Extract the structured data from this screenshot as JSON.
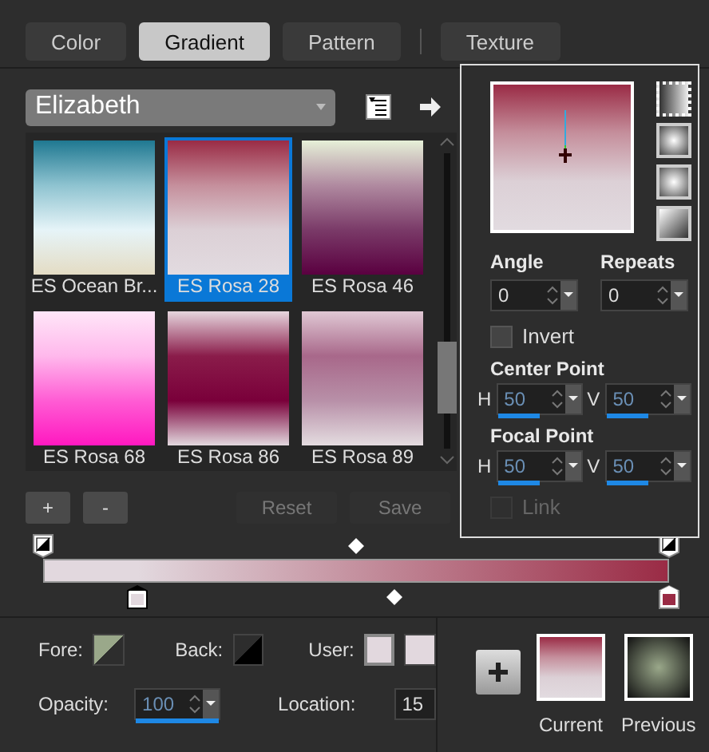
{
  "tabs": [
    {
      "label": "Color",
      "selected": false
    },
    {
      "label": "Gradient",
      "selected": true
    },
    {
      "label": "Pattern",
      "selected": false
    },
    {
      "label": "Texture",
      "selected": false
    }
  ],
  "preset_dropdown": {
    "value": "Elizabeth"
  },
  "gradients": [
    {
      "name": "ES Ocean Br...",
      "selected": false
    },
    {
      "name": "ES Rosa 28",
      "selected": true
    },
    {
      "name": "ES Rosa 46",
      "selected": false
    },
    {
      "name": "ES Rosa 68",
      "selected": false
    },
    {
      "name": "ES Rosa 86",
      "selected": false
    },
    {
      "name": "ES Rosa 89",
      "selected": false
    }
  ],
  "buttons": [
    {
      "label": "+",
      "disabled": false
    },
    {
      "label": "-",
      "disabled": false
    },
    {
      "label": "Reset",
      "disabled": true
    },
    {
      "label": "Save",
      "disabled": true
    }
  ],
  "gradient_bar": {
    "stops": [
      {
        "kind": "opacity"
      },
      {
        "kind": "opacity"
      },
      {
        "kind": "midpoint_top"
      },
      {
        "kind": "color",
        "color": "#e2d8de",
        "selected": true
      },
      {
        "kind": "color",
        "color": "#9a2b45",
        "selected": false
      },
      {
        "kind": "midpoint_bottom"
      }
    ]
  },
  "style_buttons": [
    {
      "kind": "linear",
      "selected": true
    },
    {
      "kind": "rectangular",
      "selected": false
    },
    {
      "kind": "sunburst",
      "selected": false
    },
    {
      "kind": "radial",
      "selected": false
    }
  ],
  "properties": {
    "angle": {
      "label": "Angle",
      "value": "0"
    },
    "repeats": {
      "label": "Repeats",
      "value": "0"
    },
    "invert": {
      "label": "Invert",
      "checked": false
    },
    "center_point": {
      "label": "Center Point",
      "h_label": "H",
      "h": {
        "value": "50",
        "level": 0.5
      },
      "v_label": "V",
      "v": {
        "value": "50",
        "level": 0.5
      }
    },
    "focal_point": {
      "label": "Focal Point",
      "h_label": "H",
      "h": {
        "value": "50",
        "level": 0.5
      },
      "v_label": "V",
      "v": {
        "value": "50",
        "level": 0.5
      }
    },
    "link": {
      "label": "Link",
      "checked": false,
      "disabled": true
    }
  },
  "fore": {
    "label": "Fore:"
  },
  "back": {
    "label": "Back:"
  },
  "user": {
    "label": "User:"
  },
  "opacity": {
    "label": "Opacity:",
    "value": "100",
    "level": 1
  },
  "location": {
    "label": "Location:",
    "value": "15"
  },
  "current": {
    "label": "Current"
  },
  "previous": {
    "label": "Previous"
  }
}
